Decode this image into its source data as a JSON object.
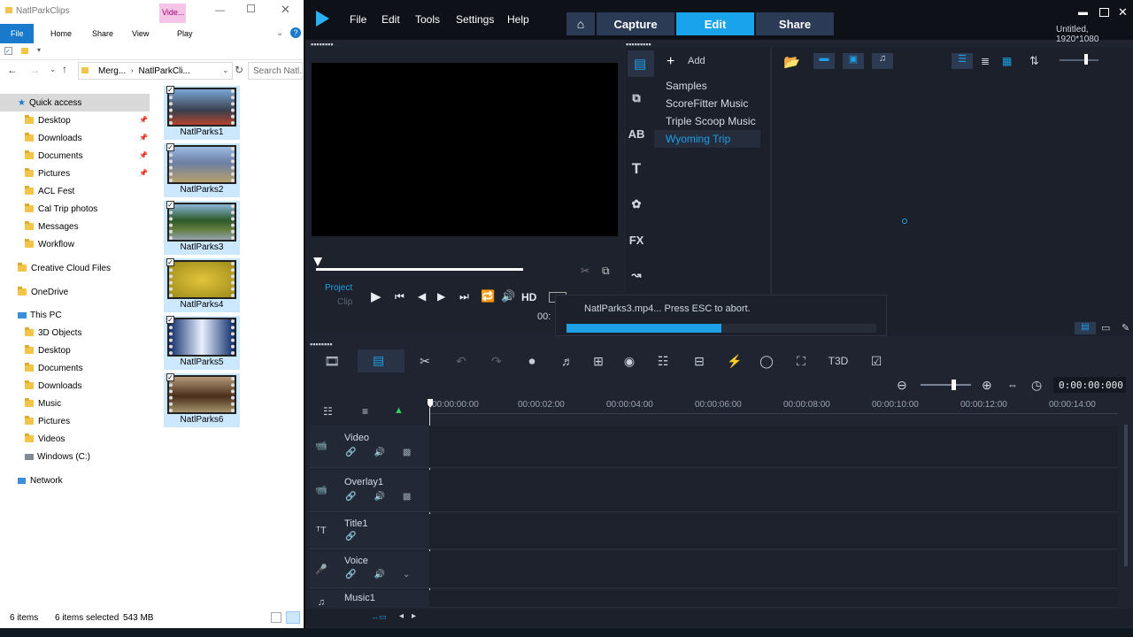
{
  "explorer": {
    "title": "NatlParkClips",
    "context_tab": "Vide...",
    "ribbon_tabs": [
      "File",
      "Home",
      "Share",
      "View",
      "Play"
    ],
    "address_parts": [
      "Merg...",
      "NatlParkCli..."
    ],
    "search_placeholder": "Search Natl...",
    "nav": {
      "quick_access": "Quick access",
      "qa_items": [
        "Desktop",
        "Downloads",
        "Documents",
        "Pictures",
        "ACL Fest",
        "Cal Trip photos",
        "Messages",
        "Workflow"
      ],
      "creative_cloud": "Creative Cloud Files",
      "onedrive": "OneDrive",
      "this_pc": "This PC",
      "pc_items": [
        "3D Objects",
        "Desktop",
        "Documents",
        "Downloads",
        "Music",
        "Pictures",
        "Videos",
        "Windows (C:)"
      ],
      "network": "Network"
    },
    "files": [
      "NatlParks1",
      "NatlParks2",
      "NatlParks3",
      "NatlParks4",
      "NatlParks5",
      "NatlParks6"
    ],
    "status": {
      "count": "6 items",
      "selected": "6 items selected",
      "size": "543 MB"
    }
  },
  "vs": {
    "menu": [
      "File",
      "Edit",
      "Tools",
      "Settings",
      "Help"
    ],
    "tabs": {
      "capture": "Capture",
      "edit": "Edit",
      "share": "Share"
    },
    "project_info": "Untitled, 1920*1080",
    "add_label": "Add",
    "library": [
      "Samples",
      "ScoreFitter Music",
      "Triple Scoop Music",
      "Wyoming Trip"
    ],
    "player": {
      "project": "Project",
      "clip": "Clip",
      "hd": "HD"
    },
    "progress_text": "NatlParks3.mp4... Press ESC to abort.",
    "progress_value": 0.5,
    "timecode": "0:00:00:000",
    "ruler": [
      "00:00:00:00",
      "00:00:02:00",
      "00:00:04:00",
      "00:00:06:00",
      "00:00:08:00",
      "00:00:10:00",
      "00:00:12:00",
      "00:00:14:00"
    ],
    "tracks": [
      "Video",
      "Overlay1",
      "Title1",
      "Voice",
      "Music1"
    ]
  },
  "colors": {
    "accent": "#1ea0e6",
    "dark": "#1f2430",
    "selected": "#cce8ff"
  }
}
